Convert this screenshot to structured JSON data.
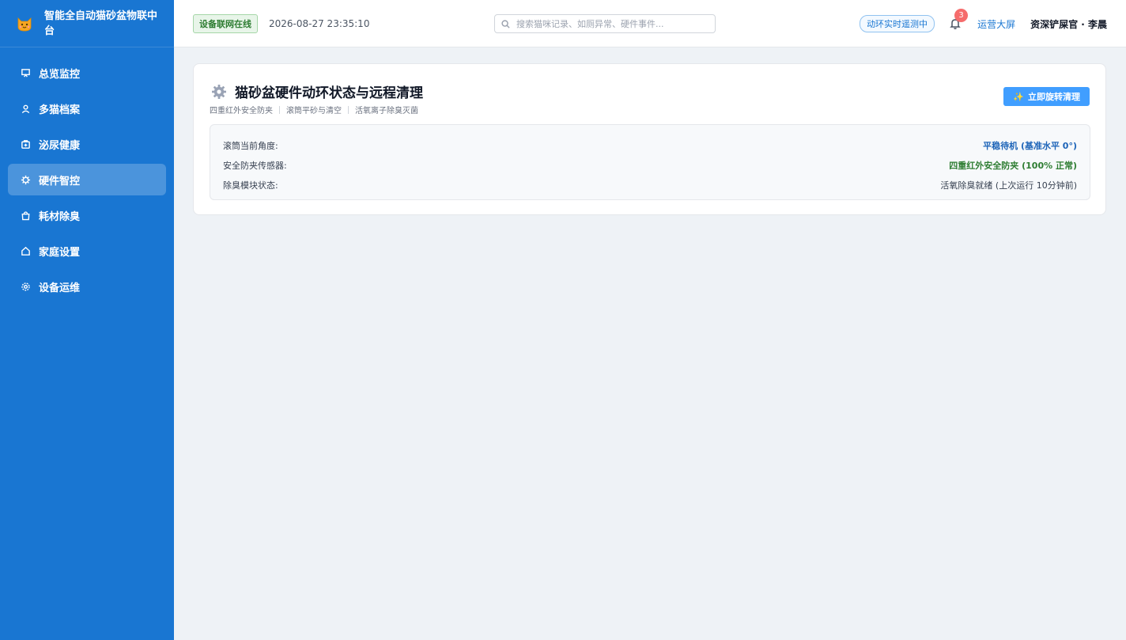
{
  "app": {
    "title": "智能全自动猫砂盆物联中台"
  },
  "sidebar": {
    "items": [
      {
        "label": "总览监控",
        "icon": "monitor-icon",
        "active": false
      },
      {
        "label": "多猫档案",
        "icon": "user-icon",
        "active": false
      },
      {
        "label": "泌尿健康",
        "icon": "medical-box-icon",
        "active": false
      },
      {
        "label": "硬件智控",
        "icon": "chip-icon",
        "active": true
      },
      {
        "label": "耗材除臭",
        "icon": "bag-icon",
        "active": false
      },
      {
        "label": "家庭设置",
        "icon": "home-icon",
        "active": false
      },
      {
        "label": "设备运维",
        "icon": "gear-icon",
        "active": false
      }
    ]
  },
  "header": {
    "online_badge": "设备联网在线",
    "datetime": "2026-08-27 23:35:10",
    "search_placeholder": "搜索猫咪记录、如厕异常、硬件事件...",
    "monitor_tag": "动环实时遥测中",
    "notification_count": "3",
    "ops_link": "运营大屏",
    "user": "资深铲屎官 · 李晨"
  },
  "card": {
    "title": "猫砂盆硬件动环状态与远程清理",
    "subtitle_parts": [
      "四重红外安全防夹",
      "滚筒平砂与清空",
      "活氧离子除臭灭菌"
    ],
    "action_button": "立即旋转清理",
    "rows": [
      {
        "label": "滚筒当前角度:",
        "value": "平稳待机 (基准水平 0°)",
        "color": "#1d64b8"
      },
      {
        "label": "安全防夹传感器:",
        "value": "四重红外安全防夹 (100% 正常)",
        "color": "#2e7d32"
      },
      {
        "label": "除臭模块状态:",
        "value": "活氧除臭就绪 (上次运行 10分钟前)",
        "color": "#374151"
      }
    ]
  },
  "colors": {
    "sidebar_bg": "#1976d2",
    "accent": "#409eff",
    "success": "#2e7d32"
  }
}
